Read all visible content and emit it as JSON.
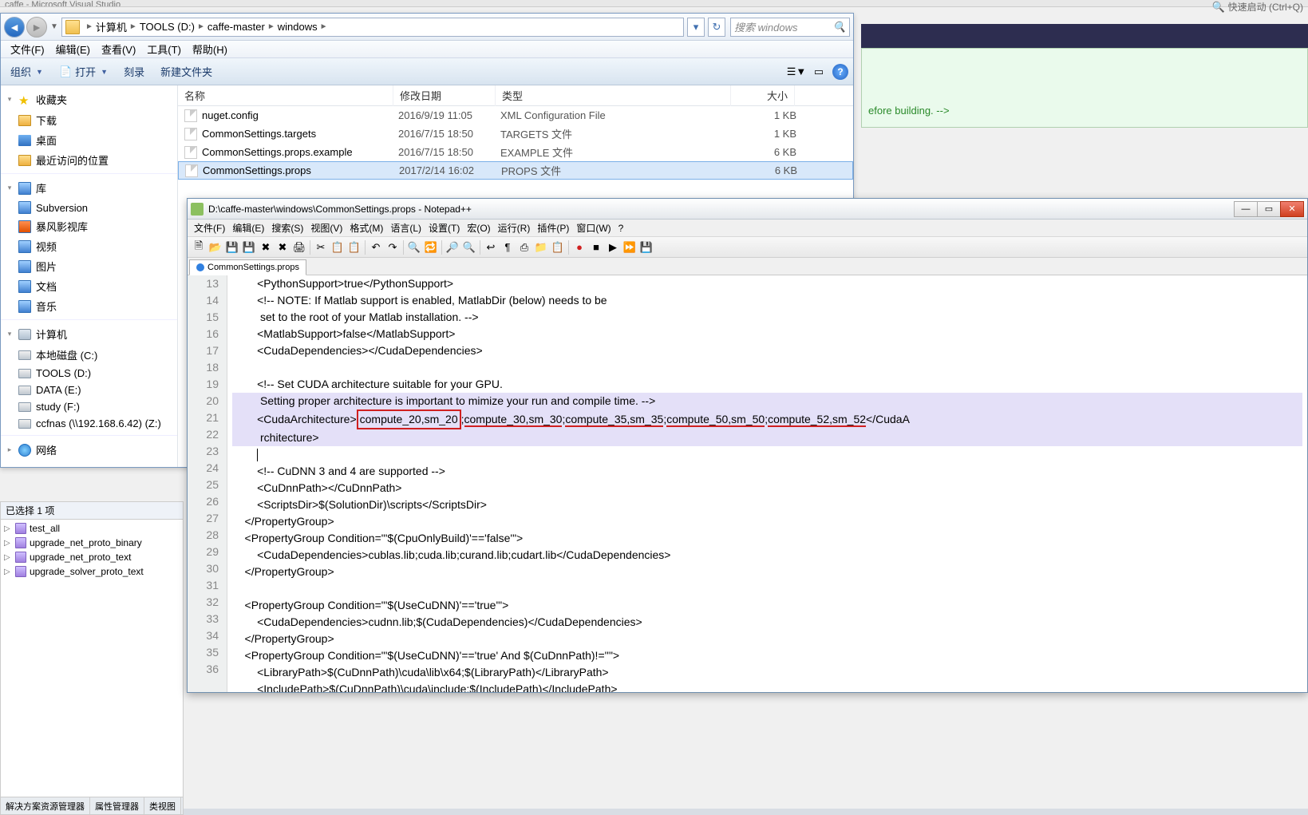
{
  "vs_title": "caffe - Microsoft Visual Studio",
  "quick_launch_placeholder": "快速启动 (Ctrl+Q)",
  "explorer": {
    "breadcrumbs": [
      "计算机",
      "TOOLS (D:)",
      "caffe-master",
      "windows"
    ],
    "search_placeholder": "搜索 windows",
    "menus": [
      "文件(F)",
      "编辑(E)",
      "查看(V)",
      "工具(T)",
      "帮助(H)"
    ],
    "toolbar": {
      "organize": "组织",
      "open": "打开",
      "burn": "刻录",
      "newfolder": "新建文件夹"
    },
    "nav": {
      "favorites": {
        "title": "收藏夹",
        "items": [
          "下载",
          "桌面",
          "最近访问的位置"
        ]
      },
      "libraries": {
        "title": "库",
        "items": [
          "Subversion",
          "暴风影视库",
          "视频",
          "图片",
          "文档",
          "音乐"
        ]
      },
      "computer": {
        "title": "计算机",
        "items": [
          "本地磁盘 (C:)",
          "TOOLS (D:)",
          "DATA (E:)",
          "study (F:)",
          "ccfnas (\\\\192.168.6.42) (Z:)"
        ]
      },
      "network": {
        "title": "网络"
      }
    },
    "columns": {
      "name": "名称",
      "date": "修改日期",
      "type": "类型",
      "size": "大小"
    },
    "files": [
      {
        "name": "nuget.config",
        "date": "2016/9/19 11:05",
        "type": "XML Configuration File",
        "size": "1 KB"
      },
      {
        "name": "CommonSettings.targets",
        "date": "2016/7/15 18:50",
        "type": "TARGETS 文件",
        "size": "1 KB"
      },
      {
        "name": "CommonSettings.props.example",
        "date": "2016/7/15 18:50",
        "type": "EXAMPLE 文件",
        "size": "6 KB"
      },
      {
        "name": "CommonSettings.props",
        "date": "2017/2/14 16:02",
        "type": "PROPS 文件",
        "size": "6 KB",
        "selected": true
      }
    ],
    "status": "已选择 1 项"
  },
  "solution_tabs": [
    "解决方案资源管理器",
    "属性管理器",
    "类视图"
  ],
  "projects": [
    "test_all",
    "upgrade_net_proto_binary",
    "upgrade_net_proto_text",
    "upgrade_solver_proto_text"
  ],
  "vs_bg_text": "efore building. -->",
  "notepadpp": {
    "title": "D:\\caffe-master\\windows\\CommonSettings.props - Notepad++",
    "menus": [
      "文件(F)",
      "编辑(E)",
      "搜索(S)",
      "视图(V)",
      "格式(M)",
      "语言(L)",
      "设置(T)",
      "宏(O)",
      "运行(R)",
      "插件(P)",
      "窗口(W)",
      "?"
    ],
    "tab": "CommonSettings.props",
    "line_start": 13,
    "lines": [
      "        <PythonSupport>true</PythonSupport>",
      "        <!-- NOTE: If Matlab support is enabled, MatlabDir (below) needs to be",
      "         set to the root of your Matlab installation. -->",
      "        <MatlabSupport>false</MatlabSupport>",
      "        <CudaDependencies></CudaDependencies>",
      "",
      "        <!-- Set CUDA architecture suitable for your GPU.",
      "         Setting proper architecture is important to mimize your run and compile time. -->",
      "        <CudaArchitecture>compute_20,sm_20;compute_30,sm_30;compute_35,sm_35;compute_50,sm_50;compute_52,sm_52</CudaA",
      "         rchitecture>",
      "        ",
      "        <!-- CuDNN 3 and 4 are supported -->",
      "        <CuDnnPath></CuDnnPath>",
      "        <ScriptsDir>$(SolutionDir)\\scripts</ScriptsDir>",
      "    </PropertyGroup>",
      "    <PropertyGroup Condition=\"'$(CpuOnlyBuild)'=='false'\">",
      "        <CudaDependencies>cublas.lib;cuda.lib;curand.lib;cudart.lib</CudaDependencies>",
      "    </PropertyGroup>",
      "",
      "    <PropertyGroup Condition=\"'$(UseCuDNN)'=='true'\">",
      "        <CudaDependencies>cudnn.lib;$(CudaDependencies)</CudaDependencies>",
      "    </PropertyGroup>",
      "    <PropertyGroup Condition=\"'$(UseCuDNN)'=='true' And $(CuDnnPath)!=''\">",
      "        <LibraryPath>$(CuDnnPath)\\cuda\\lib\\x64;$(LibraryPath)</LibraryPath>",
      "        <IncludePath>$(CuDnnPath)\\cuda\\include;$(IncludePath)</IncludePath>"
    ],
    "cuda_arch_parts": {
      "tag_open": "        <CudaArchitecture>",
      "boxed": "compute_20,sm_20",
      "sep": ";",
      "u1": "compute_30,sm_30",
      "u2": "compute_35,sm_35",
      "u3": "compute_50,sm_50",
      "u4": "compute_52,sm_52",
      "tag_close": "</CudaA"
    }
  }
}
